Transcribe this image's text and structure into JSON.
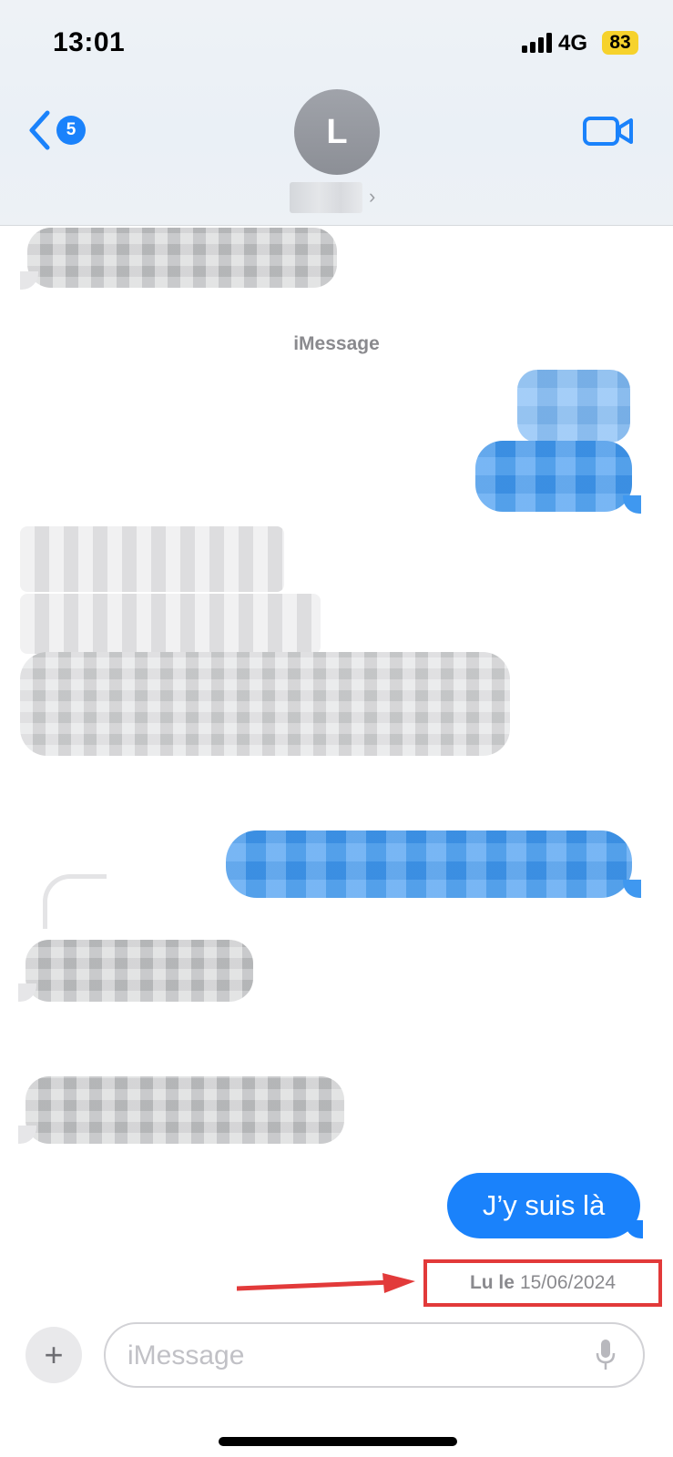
{
  "status_bar": {
    "time": "13:01",
    "network": "4G",
    "battery": "83"
  },
  "nav": {
    "back_badge": "5",
    "avatar_initial": "L"
  },
  "conversation": {
    "service_label": "iMessage",
    "last_message": "J’y suis là",
    "read_receipt": {
      "label": "Lu le",
      "date": "15/06/2024"
    }
  },
  "composer": {
    "placeholder": "iMessage",
    "plus_label": "+"
  },
  "colors": {
    "accent": "#1a82fb",
    "highlight_box": "#e23a3a",
    "battery": "#f6d22c"
  }
}
